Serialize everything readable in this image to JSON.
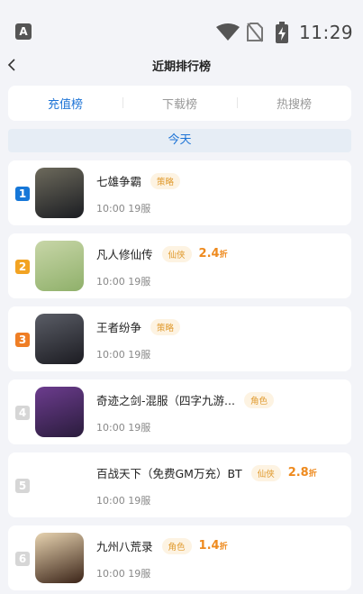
{
  "status_bar": {
    "app_badge": "A",
    "time": "11:29"
  },
  "header": {
    "title": "近期排行榜"
  },
  "tabs": [
    {
      "label": "充值榜"
    },
    {
      "label": "下载榜"
    },
    {
      "label": "热搜榜"
    }
  ],
  "day_label": "今天",
  "games": [
    {
      "rank": "1",
      "rank_color": "#1677d8",
      "name": "七雄争霸",
      "tag": "策略",
      "discount": "",
      "discount_unit": "",
      "time": "10:00",
      "server": "19服",
      "icon_colors": [
        "#6d6a5c",
        "#1b1d22"
      ]
    },
    {
      "rank": "2",
      "rank_color": "#f2a322",
      "name": "凡人修仙传",
      "tag": "仙侠",
      "discount": "2.4",
      "discount_unit": "折",
      "time": "10:00",
      "server": "19服",
      "icon_colors": [
        "#c8d6a8",
        "#8fb06a"
      ]
    },
    {
      "rank": "3",
      "rank_color": "#ef7e25",
      "name": "王者纷争",
      "tag": "策略",
      "discount": "",
      "discount_unit": "",
      "time": "10:00",
      "server": "19服",
      "icon_colors": [
        "#5a5d66",
        "#1c1c22"
      ]
    },
    {
      "rank": "4",
      "rank_color": "#d6d6d6",
      "name": "奇迹之剑-混服（四字九游...",
      "tag": "角色",
      "discount": "",
      "discount_unit": "",
      "time": "10:00",
      "server": "19服",
      "icon_colors": [
        "#6c3c8e",
        "#2a1c3c"
      ]
    },
    {
      "rank": "5",
      "rank_color": "#d6d6d6",
      "name": "百战天下（免费GM万充）BT",
      "tag": "仙侠",
      "discount": "2.8",
      "discount_unit": "折",
      "time": "10:00",
      "server": "19服",
      "icon_colors": [
        "#ffffff",
        "#ffffff"
      ]
    },
    {
      "rank": "6",
      "rank_color": "#d6d6d6",
      "name": "九州八荒录",
      "tag": "角色",
      "discount": "1.4",
      "discount_unit": "折",
      "time": "10:00",
      "server": "19服",
      "icon_colors": [
        "#e7d3b0",
        "#3b2418"
      ]
    }
  ]
}
